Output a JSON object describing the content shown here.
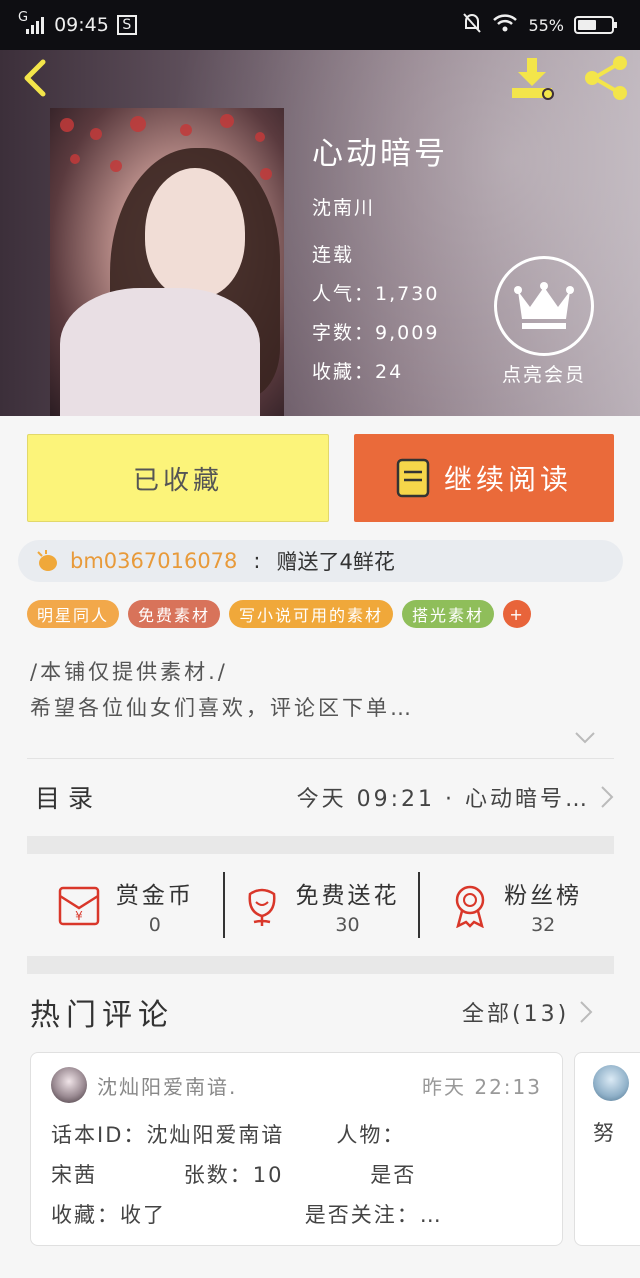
{
  "status_bar": {
    "network": "G",
    "time": "09:45",
    "sim_icon": "S",
    "battery": "55%",
    "battery_level": 0.55
  },
  "book": {
    "title": "心动暗号",
    "author": "沈南川",
    "status": "连载",
    "popularity_label": "人气：",
    "popularity": "1,730",
    "words_label": "字数：",
    "words": "9,009",
    "favorites_label": "收藏：",
    "favorites": "24"
  },
  "vip": {
    "label": "点亮会员",
    "icon": "crown-icon"
  },
  "actions": {
    "favorited": "已收藏",
    "continue_reading": "继续阅读"
  },
  "gift": {
    "user": "bm0367016078",
    "separator": ":",
    "text": "赠送了4鲜花"
  },
  "tags": [
    {
      "label": "明星同人",
      "color": "#f2a84a"
    },
    {
      "label": "免费素材",
      "color": "#d8735a"
    },
    {
      "label": "写小说可用的素材",
      "color": "#f0a83a"
    },
    {
      "label": "搭光素材",
      "color": "#8fbe5a"
    },
    {
      "label": "+",
      "color": "#e8643a"
    }
  ],
  "description": {
    "line1": "/本铺仅提供素材./",
    "line2": "希望各位仙女们喜欢，评论区下单…"
  },
  "catalog": {
    "title": "目录",
    "latest": "今天 09:21 · 心动暗号…"
  },
  "stats": [
    {
      "label": "赏金币",
      "value": "0",
      "icon": "red-envelope-icon"
    },
    {
      "label": "免费送花",
      "value": "30",
      "icon": "flower-icon"
    },
    {
      "label": "粉丝榜",
      "value": "32",
      "icon": "medal-icon"
    }
  ],
  "comments": {
    "title": "热门评论",
    "all": "全部(13)",
    "items": [
      {
        "user": "沈灿阳爱南谙.",
        "time": "昨天 22:13",
        "body": "话本ID：沈灿阳爱南谙      人物：\n宋茜          张数：10          是否\n收藏：收了                是否关注：…"
      },
      {
        "text": "努"
      }
    ]
  }
}
